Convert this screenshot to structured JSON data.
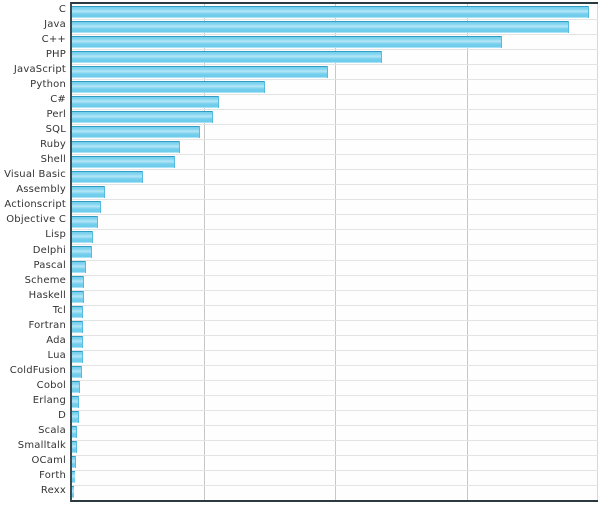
{
  "chart_data": {
    "type": "bar",
    "orientation": "horizontal",
    "title": "",
    "subtitle": "",
    "xlabel": "",
    "ylabel": "",
    "grid": true,
    "legend": false,
    "xlim": [
      0,
      4
    ],
    "x_tick_labels": [
      "",
      "",
      "",
      ""
    ],
    "categories": [
      "C",
      "Java",
      "C++",
      "PHP",
      "JavaScript",
      "Python",
      "C#",
      "Perl",
      "SQL",
      "Ruby",
      "Shell",
      "Visual Basic",
      "Assembly",
      "Actionscript",
      "Objective C",
      "Lisp",
      "Delphi",
      "Pascal",
      "Scheme",
      "Haskell",
      "Tcl",
      "Fortran",
      "Ada",
      "Lua",
      "ColdFusion",
      "Cobol",
      "Erlang",
      "D",
      "Scala",
      "Smalltalk",
      "OCaml",
      "Forth",
      "Rexx"
    ],
    "values": [
      3.93,
      3.78,
      3.27,
      2.36,
      1.95,
      1.47,
      1.12,
      1.07,
      0.97,
      0.82,
      0.78,
      0.54,
      0.25,
      0.22,
      0.2,
      0.16,
      0.15,
      0.11,
      0.09,
      0.09,
      0.08,
      0.08,
      0.08,
      0.08,
      0.075,
      0.06,
      0.055,
      0.05,
      0.04,
      0.04,
      0.03,
      0.02,
      0.005
    ],
    "bar_color": "#7ed3ee",
    "bar_edge_color": "#2f9dc4",
    "background_color": "#ffffff",
    "plot_background_color": "#fefefe",
    "gridline_color": "#c8c8c8",
    "axis_color": "#2b3940",
    "label_color": "#333333"
  }
}
